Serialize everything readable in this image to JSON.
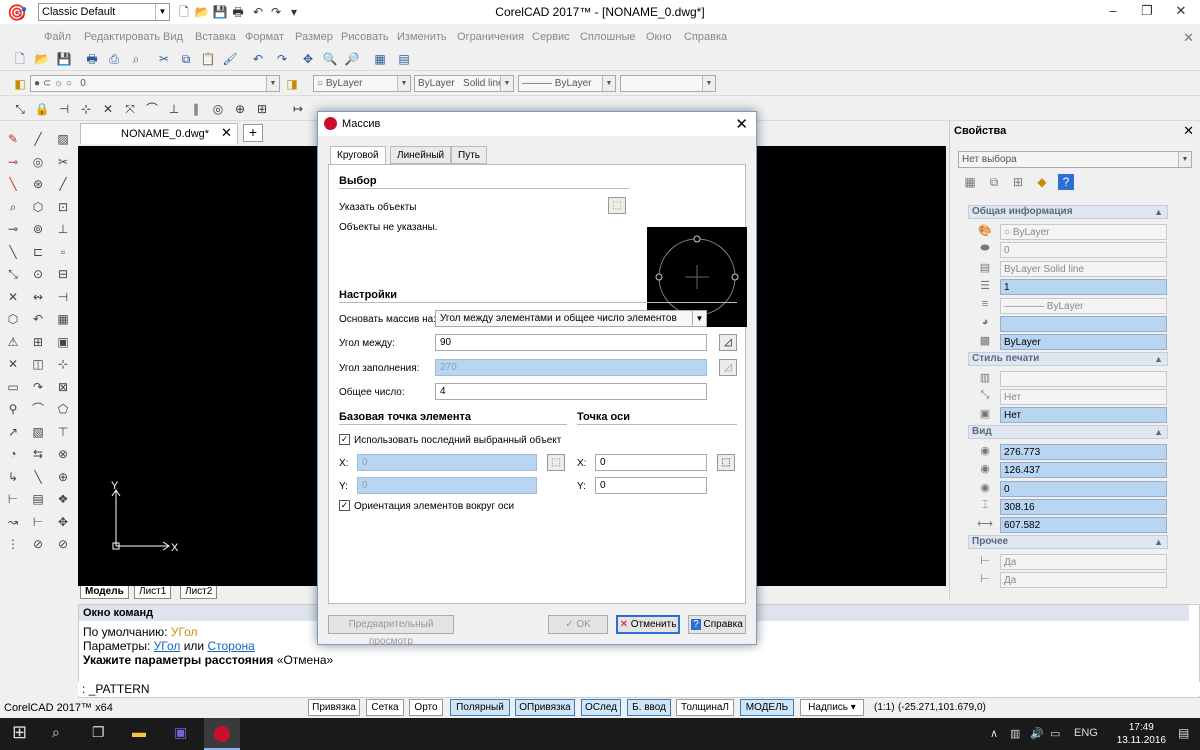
{
  "app": {
    "title": "CorelCAD 2017™ - [NONAME_0.dwg*]",
    "workspace": "Classic Default"
  },
  "menu": [
    "Файл",
    "Редактировать",
    "Вид",
    "Вставка",
    "Формат",
    "Размер",
    "Рисовать",
    "Изменить",
    "Ограничения",
    "Сервис",
    "Сплошные",
    "Окно",
    "Справка"
  ],
  "layer_toolbar": {
    "layer": "0",
    "color": "ByLayer",
    "linetype": "ByLayer",
    "linetype_name": "Solid line",
    "lineweight": "ByLayer"
  },
  "document": {
    "tab": "NONAME_0.dwg*",
    "layout_tabs": [
      "Модель",
      "Лист1",
      "Лист2"
    ],
    "ucs_x": "X",
    "ucs_y": "Y"
  },
  "dialog": {
    "title": "Массив",
    "tabs": [
      "Круговой",
      "Линейный",
      "Путь"
    ],
    "selection_header": "Выбор",
    "select_objects": "Указать объекты",
    "no_objects": "Объекты не указаны.",
    "settings_header": "Настройки",
    "base_on_label": "Основать массив на:",
    "base_on_value": "Угол между элементами и общее число элементов",
    "angle_between_label": "Угол между:",
    "angle_between": "90",
    "fill_angle_label": "Угол заполнения:",
    "fill_angle": "270",
    "total_label": "Общее число:",
    "total": "4",
    "base_point_header": "Базовая точка элемента",
    "axis_point_header": "Точка оси",
    "use_last_label": "Использовать последний выбранный объект",
    "x_label": "X:",
    "y_label": "Y:",
    "base_x": "0",
    "base_y": "0",
    "axis_x": "0",
    "axis_y": "0",
    "orient_label": "Ориентация элементов вокруг оси",
    "preview_btn": "Предварительный просмотр",
    "ok_btn": "OK",
    "cancel_btn": "Отменить",
    "help_btn": "Справка"
  },
  "properties": {
    "title": "Свойства",
    "selection": "Нет выбора",
    "general_header": "Общая информация",
    "general": [
      "ByLayer",
      "0",
      "ByLayer    Solid line",
      "1",
      "———— ByLayer",
      "",
      "ByLayer"
    ],
    "print_header": "Стиль печати",
    "print": [
      "",
      "Нет",
      "Нет"
    ],
    "view_header": "Вид",
    "view": [
      "276.773",
      "126.437",
      "0",
      "308.16",
      "607.582"
    ],
    "other_header": "Прочее",
    "other": [
      "Да",
      "Да"
    ]
  },
  "command": {
    "title": "Окно команд",
    "default_label": "По умолчанию: ",
    "default_value": "УГол",
    "params_label": "Параметры: ",
    "param1": "УГол",
    "or_text": " или ",
    "param2": "Сторона",
    "prompt": "Укажите параметры расстояния",
    "prompt_suffix": " «Отмена»",
    "input": ": _PATTERN"
  },
  "status": {
    "app": "CorelCAD 2017™ x64",
    "buttons": [
      "Привязка",
      "Сетка",
      "Орто",
      "Полярный",
      "ОПривязка",
      "ОСлед",
      "Б. ввод",
      "ТолщинаЛ",
      "МОДЕЛЬ",
      "Надпись"
    ],
    "scale": "(1:1)",
    "coords": "(-25.271,101.679,0)"
  },
  "taskbar": {
    "lang": "ENG",
    "time": "17:49",
    "date": "13.11.2016"
  }
}
